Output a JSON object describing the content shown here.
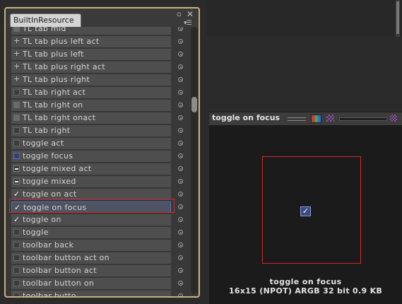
{
  "panel": {
    "tab_title": "BuiltInResource",
    "maximize_icon": "maximize-icon",
    "close_icon": "close-icon",
    "menu_icon": "panel-menu-icon",
    "accent_color": "#c9b27a",
    "items": [
      {
        "label": "TL tab mid",
        "icon": "square"
      },
      {
        "label": "TL tab plus left act",
        "icon": "plus"
      },
      {
        "label": "TL tab plus left",
        "icon": "plus"
      },
      {
        "label": "TL tab plus right act",
        "icon": "plus"
      },
      {
        "label": "TL tab plus right",
        "icon": "plus"
      },
      {
        "label": "TL tab right act",
        "icon": "empty"
      },
      {
        "label": "TL tab right on",
        "icon": "square"
      },
      {
        "label": "TL tab right onact",
        "icon": "square"
      },
      {
        "label": "TL tab right",
        "icon": "empty"
      },
      {
        "label": "toggle act",
        "icon": "empty"
      },
      {
        "label": "toggle focus",
        "icon": "blue"
      },
      {
        "label": "toggle mixed act",
        "icon": "mixed"
      },
      {
        "label": "toggle mixed",
        "icon": "mixed"
      },
      {
        "label": "toggle on act",
        "icon": "check"
      },
      {
        "label": "toggle on focus",
        "icon": "check",
        "selected": true
      },
      {
        "label": "toggle on",
        "icon": "check"
      },
      {
        "label": "toggle",
        "icon": "empty"
      },
      {
        "label": "toolbar back",
        "icon": "empty"
      },
      {
        "label": "toolbar button act on",
        "icon": "empty"
      },
      {
        "label": "toolbar button act",
        "icon": "empty"
      },
      {
        "label": "toolbar button on",
        "icon": "empty"
      },
      {
        "label": "toolbar butto...",
        "icon": "empty"
      }
    ]
  },
  "preview": {
    "title": "toggle on focus",
    "name": "toggle on focus",
    "info": "16x15 (NPOT)  ARGB 32 bit  0.9 KB",
    "selection_color": "#d02b2b"
  }
}
